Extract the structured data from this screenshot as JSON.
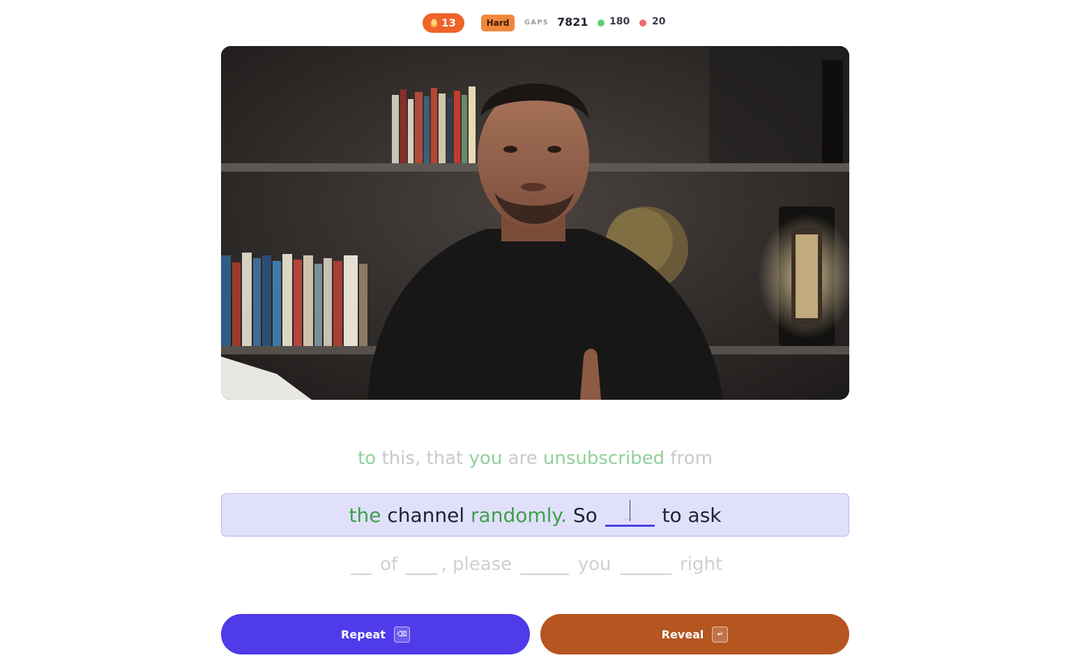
{
  "stats": {
    "streak": "13",
    "difficulty": "Hard",
    "gaps_label": "GAPS",
    "gaps_count": "7821",
    "correct": "180",
    "wrong": "20"
  },
  "video": {
    "subject": "man in black t-shirt speaking in front of bookshelves"
  },
  "transcript": {
    "previous": {
      "w1": "to",
      "w2": "this, that",
      "w3": "you",
      "w4": "are",
      "w5": "unsubscribed",
      "w6": "from"
    },
    "current": {
      "w1": "the",
      "w2": "channel",
      "w3": "randomly.",
      "w4": "So",
      "w5": "to ask",
      "gap_placeholder": "..."
    },
    "next": {
      "w1": "of",
      "w2": ", please",
      "w3": "you",
      "w4": "right"
    }
  },
  "actions": {
    "repeat_label": "Repeat",
    "repeat_key": "⌫",
    "reveal_label": "Reveal",
    "reveal_key": "↵"
  },
  "colors": {
    "primary": "#4f3be9",
    "reveal": "#b5551f",
    "streak": "#f0632a",
    "difficulty": "#f0873a",
    "correct_word": "#3e9e4b",
    "current_bg": "#e0e0fb"
  }
}
